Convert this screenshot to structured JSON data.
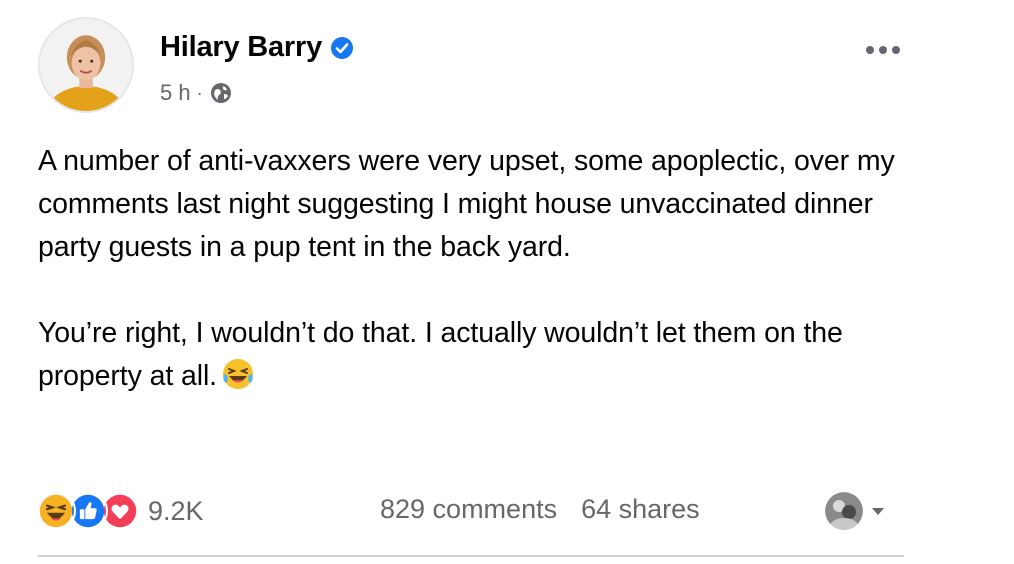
{
  "post": {
    "author": {
      "name": "Hilary Barry",
      "verified": true,
      "avatar_icon": "profile-photo"
    },
    "meta": {
      "time": "5 h",
      "separator": "·",
      "audience_icon": "globe-icon"
    },
    "more_icon": "more-options-icon",
    "text": {
      "paragraph_1": "A number of anti-vaxxers were very upset, some apoplectic, over my comments last night suggesting I might house unvaccinated dinner party guests in a pup tent in the back yard.",
      "paragraph_2": "You’re right, I wouldn’t do that. I actually wouldn’t let them on the property at all.",
      "emoji": "laughing-tears-emoji"
    },
    "reactions": {
      "icons": [
        "haha-reaction-icon",
        "like-reaction-icon",
        "love-reaction-icon"
      ],
      "count": "9.2K"
    },
    "stats": {
      "comments": "829 comments",
      "shares": "64 shares"
    }
  },
  "colors": {
    "text_primary": "#050505",
    "text_secondary": "#65676b",
    "verified_blue": "#1877f2",
    "like_blue": "#1877f2",
    "love_red": "#f33e58",
    "haha_yellow": "#f7b125",
    "divider": "#ced0d4"
  }
}
